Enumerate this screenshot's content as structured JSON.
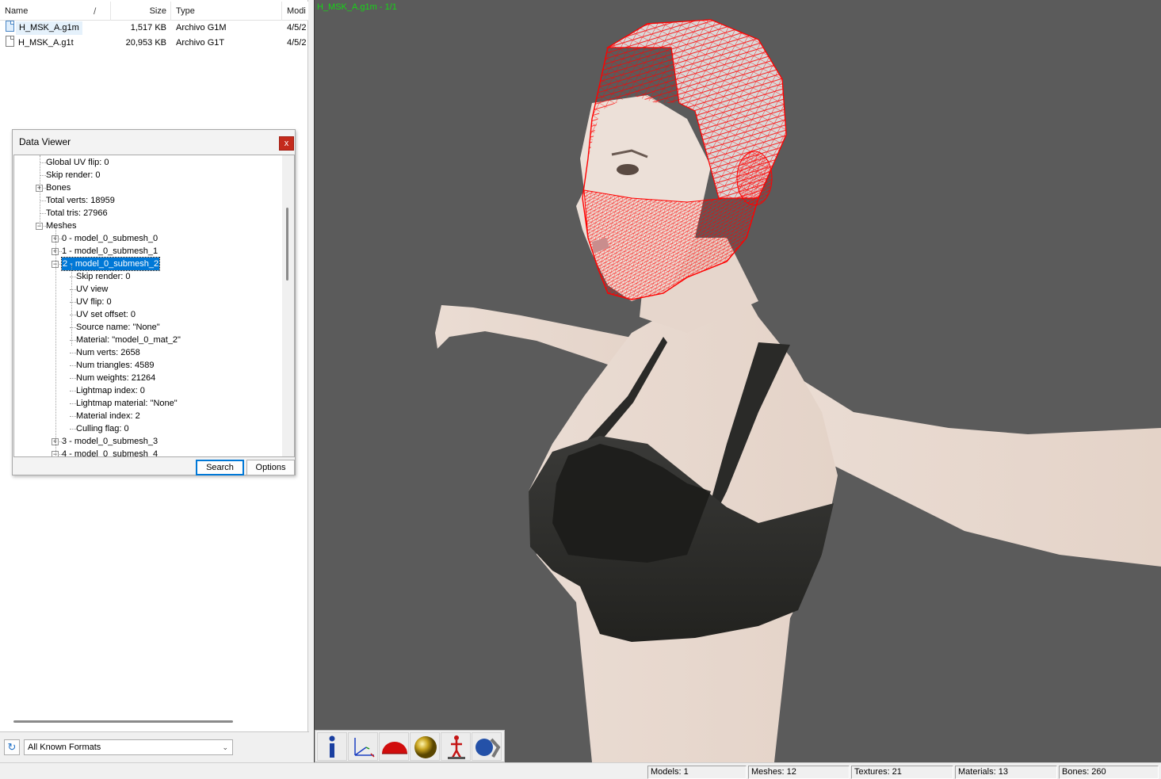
{
  "file_list": {
    "columns": {
      "name": "Name",
      "size": "Size",
      "type": "Type",
      "modified": "Modi"
    },
    "sort_indicator": "/",
    "rows": [
      {
        "name": "H_MSK_A.g1m",
        "size": "1,517 KB",
        "type": "Archivo G1M",
        "modified": "4/5/2"
      },
      {
        "name": "H_MSK_A.g1t",
        "size": "20,953 KB",
        "type": "Archivo G1T",
        "modified": "4/5/2"
      }
    ]
  },
  "data_viewer": {
    "title": "Data Viewer",
    "close_label": "x",
    "tree": [
      {
        "label": "Global UV flip: 0"
      },
      {
        "label": "Skip render: 0"
      },
      {
        "label": "Bones",
        "expander": "+"
      },
      {
        "label": "Total verts: 18959"
      },
      {
        "label": "Total tris: 27966"
      },
      {
        "label": "Meshes",
        "expander": "−"
      },
      {
        "label": "0 - model_0_submesh_0",
        "expander": "+"
      },
      {
        "label": "1 - model_0_submesh_1",
        "expander": "+"
      },
      {
        "label": "2 - model_0_submesh_2",
        "expander": "−",
        "selected": true
      },
      {
        "label": "Skip render: 0"
      },
      {
        "label": "UV view"
      },
      {
        "label": "UV flip: 0"
      },
      {
        "label": "UV set offset: 0"
      },
      {
        "label": "Source name: \"None\""
      },
      {
        "label": "Material: \"model_0_mat_2\""
      },
      {
        "label": "Num verts: 2658"
      },
      {
        "label": "Num triangles: 4589"
      },
      {
        "label": "Num weights: 21264"
      },
      {
        "label": "Lightmap index: 0"
      },
      {
        "label": "Lightmap material: \"None\""
      },
      {
        "label": "Material index: 2"
      },
      {
        "label": "Culling flag: 0"
      },
      {
        "label": "3 - model_0_submesh_3",
        "expander": "+"
      },
      {
        "label": "4 - model_0_submesh_4",
        "expander": "−"
      }
    ],
    "search_label": "Search",
    "options_label": "Options"
  },
  "format_filter": {
    "selected": "All Known Formats",
    "refresh_icon": "refresh-icon"
  },
  "viewport": {
    "label": "H_MSK_A.g1m - 1/1",
    "background": "#5b5b5b",
    "wireframe_color": "#ff0000",
    "toolbar": [
      "info-icon",
      "axes-icon",
      "hemisphere-icon",
      "sphere-icon",
      "skeleton-icon",
      "animation-icon"
    ]
  },
  "status": {
    "models": "Models: 1",
    "meshes": "Meshes: 12",
    "textures": "Textures: 21",
    "materials": "Materials: 13",
    "bones": "Bones: 260"
  }
}
